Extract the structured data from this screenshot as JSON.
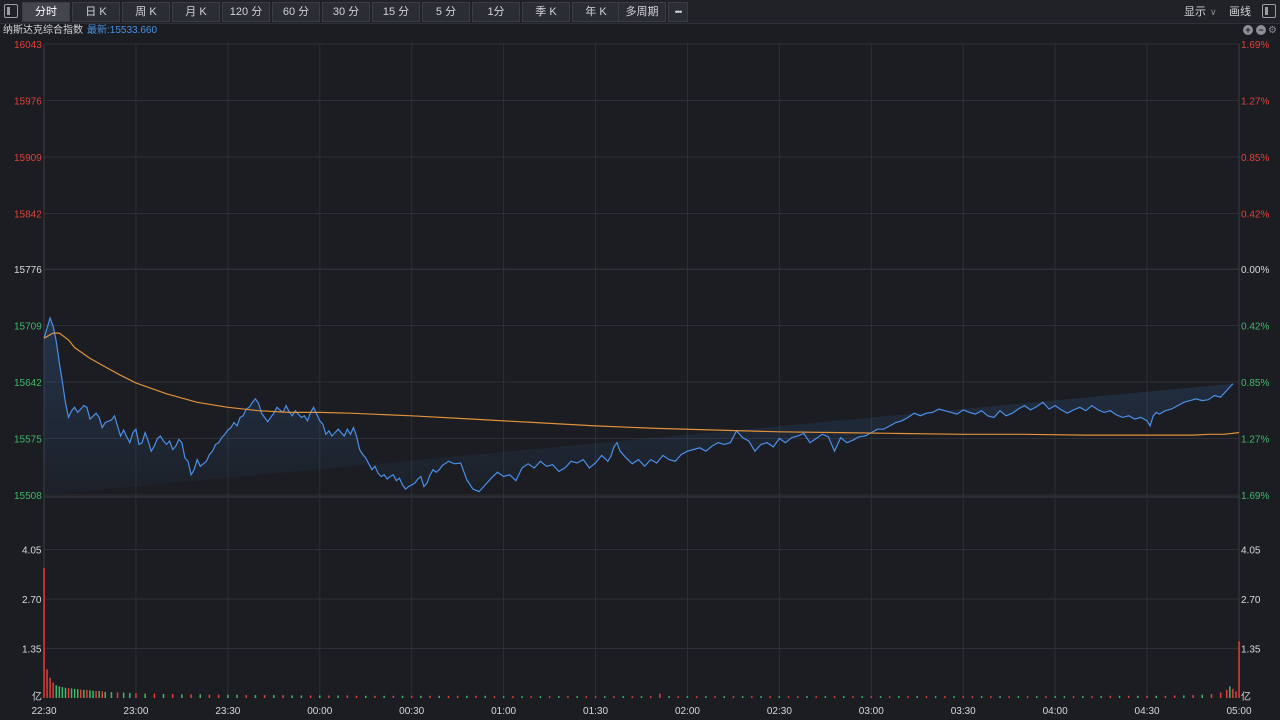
{
  "toolbar": {
    "tabs": [
      {
        "label": "分时",
        "active": true
      },
      {
        "label": "日 K",
        "active": false
      },
      {
        "label": "周 K",
        "active": false
      },
      {
        "label": "月 K",
        "active": false
      },
      {
        "label": "120 分",
        "active": false
      },
      {
        "label": "60 分",
        "active": false
      },
      {
        "label": "30 分",
        "active": false
      },
      {
        "label": "15 分",
        "active": false
      },
      {
        "label": "5 分",
        "active": false
      },
      {
        "label": "1分",
        "active": false
      },
      {
        "label": "季 K",
        "active": false
      },
      {
        "label": "年 K",
        "active": false
      },
      {
        "label": "多周期",
        "active": false
      }
    ],
    "more_label": "•••",
    "display_label": "显示",
    "draw_label": "画线"
  },
  "info": {
    "name": "纳斯达克综合指数",
    "latest": "最新:15533.660"
  },
  "colors": {
    "price_line": "#4a8fe8",
    "avg_line": "#e0913a",
    "up": "#e0403a",
    "down": "#3fb76a",
    "neutral": "#d6d8dc",
    "grid": "#2c2f36"
  },
  "chart_data": {
    "type": "line",
    "title": "",
    "price_axis": {
      "ylim": [
        15508,
        16043
      ],
      "left_ticks": [
        {
          "label": "16043",
          "value": 16043,
          "tone": "up"
        },
        {
          "label": "15976",
          "value": 15976,
          "tone": "up"
        },
        {
          "label": "15909",
          "value": 15909,
          "tone": "up"
        },
        {
          "label": "15842",
          "value": 15842,
          "tone": "up"
        },
        {
          "label": "15776",
          "value": 15776,
          "tone": "neutral"
        },
        {
          "label": "15709",
          "value": 15709,
          "tone": "down"
        },
        {
          "label": "15642",
          "value": 15642,
          "tone": "down"
        },
        {
          "label": "15575",
          "value": 15575,
          "tone": "down"
        },
        {
          "label": "15508",
          "value": 15508,
          "tone": "down"
        }
      ],
      "right_ticks": [
        {
          "label": "1.69%",
          "value": 16043,
          "tone": "up"
        },
        {
          "label": "1.27%",
          "value": 15976,
          "tone": "up"
        },
        {
          "label": "0.85%",
          "value": 15909,
          "tone": "up"
        },
        {
          "label": "0.42%",
          "value": 15842,
          "tone": "up"
        },
        {
          "label": "0.00%",
          "value": 15776,
          "tone": "neutral"
        },
        {
          "label": "0.42%",
          "value": 15709,
          "tone": "down"
        },
        {
          "label": "0.85%",
          "value": 15642,
          "tone": "down"
        },
        {
          "label": "1.27%",
          "value": 15575,
          "tone": "down"
        },
        {
          "label": "1.69%",
          "value": 15508,
          "tone": "down"
        }
      ]
    },
    "volume_axis": {
      "ylim": [
        0,
        5.4
      ],
      "ticks": [
        {
          "label": "4.05",
          "value": 4.05
        },
        {
          "label": "2.70",
          "value": 2.7
        },
        {
          "label": "1.35",
          "value": 1.35
        }
      ],
      "unit_label": "亿"
    },
    "x_ticks": [
      "22:30",
      "23:00",
      "23:30",
      "00:00",
      "00:30",
      "01:00",
      "01:30",
      "02:00",
      "02:30",
      "03:00",
      "03:30",
      "04:00",
      "04:30",
      "05:00"
    ],
    "x_tick_minutes": [
      0,
      30,
      60,
      90,
      120,
      150,
      180,
      210,
      240,
      270,
      300,
      330,
      360,
      390
    ],
    "price_series": {
      "name": "",
      "x_minutes": [
        0,
        2,
        3,
        4,
        5,
        6,
        7,
        8,
        9,
        10,
        11,
        12,
        13,
        14,
        15,
        17,
        18,
        19,
        20,
        22,
        23,
        24,
        25,
        26,
        27,
        28,
        29,
        30,
        31,
        32,
        33,
        34,
        35,
        36,
        37,
        38,
        39,
        40,
        41,
        42,
        43,
        44,
        45,
        46,
        47,
        48,
        49,
        50,
        51,
        52,
        53,
        54,
        55,
        56,
        57,
        58,
        59,
        60,
        61,
        62,
        63,
        64,
        65,
        66,
        67,
        68,
        69,
        70,
        71,
        72,
        73,
        74,
        75,
        76,
        77,
        78,
        79,
        80,
        81,
        82,
        83,
        84,
        85,
        86,
        87,
        88,
        89,
        90,
        91,
        92,
        93,
        94,
        95,
        96,
        97,
        98,
        99,
        100,
        101,
        102,
        103,
        104,
        105,
        106,
        107,
        108,
        109,
        110,
        111,
        112,
        113,
        114,
        115,
        116,
        117,
        118,
        119,
        120,
        121,
        122,
        123,
        124,
        125,
        126,
        127,
        128,
        129,
        130,
        132,
        134,
        136,
        138,
        140,
        142,
        144,
        146,
        148,
        150,
        152,
        154,
        156,
        158,
        160,
        162,
        164,
        166,
        168,
        170,
        172,
        174,
        176,
        178,
        180,
        182,
        184,
        185,
        186,
        187,
        188,
        190,
        192,
        194,
        196,
        198,
        200,
        202,
        204,
        206,
        208,
        210,
        212,
        214,
        216,
        218,
        220,
        222,
        224,
        226,
        228,
        230,
        232,
        234,
        236,
        238,
        240,
        242,
        244,
        246,
        248,
        250,
        252,
        254,
        256,
        258,
        260,
        262,
        264,
        266,
        268,
        270,
        272,
        274,
        276,
        278,
        280,
        282,
        284,
        286,
        288,
        290,
        292,
        294,
        296,
        298,
        300,
        302,
        304,
        306,
        308,
        310,
        312,
        314,
        316,
        318,
        320,
        322,
        324,
        326,
        328,
        330,
        332,
        334,
        336,
        338,
        340,
        342,
        344,
        346,
        348,
        350,
        352,
        354,
        356,
        358,
        360,
        361,
        362,
        363,
        364,
        366,
        368,
        370,
        372,
        374,
        376,
        378,
        380,
        382,
        384,
        386,
        388,
        390
      ],
      "values": [
        15694,
        15718,
        15708,
        15690,
        15665,
        15642,
        15618,
        15600,
        15608,
        15612,
        15606,
        15610,
        15614,
        15612,
        15598,
        15605,
        15600,
        15588,
        15594,
        15597,
        15602,
        15590,
        15578,
        15585,
        15577,
        15570,
        15582,
        15586,
        15568,
        15570,
        15582,
        15572,
        15560,
        15566,
        15575,
        15578,
        15572,
        15568,
        15572,
        15562,
        15566,
        15574,
        15570,
        15552,
        15548,
        15532,
        15538,
        15550,
        15542,
        15545,
        15548,
        15556,
        15560,
        15568,
        15570,
        15576,
        15580,
        15585,
        15588,
        15594,
        15590,
        15600,
        15602,
        15610,
        15612,
        15618,
        15622,
        15617,
        15605,
        15600,
        15595,
        15600,
        15605,
        15612,
        15609,
        15606,
        15614,
        15607,
        15602,
        15608,
        15604,
        15600,
        15602,
        15596,
        15606,
        15612,
        15604,
        15596,
        15592,
        15580,
        15584,
        15578,
        15582,
        15586,
        15582,
        15578,
        15586,
        15580,
        15588,
        15578,
        15562,
        15556,
        15552,
        15545,
        15538,
        15542,
        15534,
        15530,
        15532,
        15527,
        15530,
        15532,
        15525,
        15528,
        15520,
        15515,
        15518,
        15520,
        15522,
        15527,
        15530,
        15518,
        15522,
        15532,
        15538,
        15535,
        15538,
        15543,
        15548,
        15545,
        15546,
        15526,
        15515,
        15512,
        15520,
        15528,
        15535,
        15530,
        15532,
        15525,
        15540,
        15545,
        15540,
        15548,
        15542,
        15544,
        15536,
        15540,
        15548,
        15546,
        15550,
        15540,
        15546,
        15555,
        15548,
        15554,
        15565,
        15570,
        15560,
        15552,
        15545,
        15550,
        15542,
        15550,
        15546,
        15555,
        15550,
        15548,
        15556,
        15560,
        15562,
        15564,
        15560,
        15566,
        15570,
        15568,
        15570,
        15584,
        15576,
        15572,
        15560,
        15568,
        15570,
        15565,
        15575,
        15570,
        15576,
        15578,
        15581,
        15570,
        15575,
        15580,
        15577,
        15560,
        15576,
        15570,
        15573,
        15577,
        15578,
        15582,
        15586,
        15586,
        15590,
        15594,
        15596,
        15600,
        15605,
        15602,
        15605,
        15606,
        15610,
        15608,
        15606,
        15604,
        15609,
        15606,
        15604,
        15608,
        15602,
        15600,
        15608,
        15602,
        15605,
        15610,
        15614,
        15609,
        15613,
        15618,
        15610,
        15614,
        15609,
        15605,
        15609,
        15612,
        15608,
        15614,
        15609,
        15606,
        15608,
        15603,
        15600,
        15602,
        15598,
        15600,
        15596,
        15590,
        15602,
        15606,
        15604,
        15608,
        15610,
        15614,
        15618,
        15620,
        15622,
        15620,
        15621,
        15626,
        15624,
        15632,
        15640
      ],
      "last_value": 15533.66
    },
    "avg_series": {
      "name": "",
      "x_minutes": [
        0,
        3,
        5,
        8,
        10,
        15,
        20,
        25,
        30,
        40,
        50,
        60,
        70,
        80,
        90,
        100,
        120,
        140,
        160,
        180,
        200,
        220,
        240,
        260,
        280,
        300,
        320,
        340,
        360,
        375,
        380,
        385,
        390
      ],
      "values": [
        15694,
        15700,
        15700,
        15692,
        15683,
        15670,
        15660,
        15650,
        15641,
        15628,
        15618,
        15612,
        15608,
        15606,
        15606,
        15605,
        15602,
        15598,
        15594,
        15590,
        15587,
        15585,
        15583,
        15582,
        15581,
        15580,
        15580,
        15579,
        15579,
        15579,
        15580,
        15580,
        15582
      ]
    },
    "volume_series": {
      "name": "",
      "x_minutes": [
        0,
        1,
        2,
        3,
        4,
        5,
        6,
        7,
        8,
        9,
        10,
        11,
        12,
        13,
        14,
        15,
        16,
        17,
        18,
        19,
        20,
        22,
        24,
        26,
        28,
        30,
        33,
        36,
        39,
        42,
        45,
        48,
        51,
        54,
        57,
        60,
        63,
        66,
        69,
        72,
        75,
        78,
        81,
        84,
        87,
        90,
        93,
        96,
        99,
        102,
        105,
        108,
        111,
        114,
        117,
        120,
        123,
        126,
        129,
        132,
        135,
        138,
        141,
        144,
        147,
        150,
        153,
        156,
        159,
        162,
        165,
        168,
        171,
        174,
        177,
        180,
        183,
        186,
        189,
        192,
        195,
        198,
        201,
        204,
        207,
        210,
        213,
        216,
        219,
        222,
        225,
        228,
        231,
        234,
        237,
        240,
        243,
        246,
        249,
        252,
        255,
        258,
        261,
        264,
        267,
        270,
        273,
        276,
        279,
        282,
        285,
        288,
        291,
        294,
        297,
        300,
        303,
        306,
        309,
        312,
        315,
        318,
        321,
        324,
        327,
        330,
        333,
        336,
        339,
        342,
        345,
        348,
        351,
        354,
        357,
        360,
        363,
        366,
        369,
        372,
        375,
        378,
        381,
        384,
        386,
        387,
        388,
        389,
        390
      ],
      "values": [
        3.55,
        0.78,
        0.55,
        0.42,
        0.35,
        0.32,
        0.3,
        0.28,
        0.27,
        0.26,
        0.25,
        0.24,
        0.23,
        0.22,
        0.22,
        0.21,
        0.2,
        0.19,
        0.19,
        0.18,
        0.17,
        0.16,
        0.15,
        0.15,
        0.14,
        0.13,
        0.12,
        0.12,
        0.11,
        0.11,
        0.1,
        0.1,
        0.1,
        0.09,
        0.09,
        0.09,
        0.09,
        0.08,
        0.08,
        0.08,
        0.08,
        0.08,
        0.07,
        0.07,
        0.07,
        0.07,
        0.07,
        0.07,
        0.07,
        0.06,
        0.06,
        0.06,
        0.06,
        0.06,
        0.06,
        0.06,
        0.06,
        0.06,
        0.06,
        0.06,
        0.06,
        0.06,
        0.06,
        0.06,
        0.05,
        0.05,
        0.05,
        0.05,
        0.05,
        0.05,
        0.05,
        0.05,
        0.05,
        0.05,
        0.05,
        0.05,
        0.05,
        0.05,
        0.05,
        0.05,
        0.05,
        0.05,
        0.12,
        0.05,
        0.05,
        0.05,
        0.05,
        0.05,
        0.05,
        0.05,
        0.05,
        0.05,
        0.05,
        0.05,
        0.05,
        0.05,
        0.05,
        0.05,
        0.05,
        0.05,
        0.05,
        0.05,
        0.05,
        0.05,
        0.05,
        0.05,
        0.05,
        0.05,
        0.05,
        0.05,
        0.05,
        0.05,
        0.05,
        0.05,
        0.05,
        0.05,
        0.05,
        0.05,
        0.05,
        0.05,
        0.05,
        0.05,
        0.05,
        0.05,
        0.05,
        0.05,
        0.05,
        0.05,
        0.05,
        0.05,
        0.05,
        0.06,
        0.06,
        0.06,
        0.06,
        0.06,
        0.06,
        0.06,
        0.07,
        0.07,
        0.08,
        0.09,
        0.11,
        0.15,
        0.22,
        0.32,
        0.25,
        0.18,
        1.55
      ],
      "colors": [
        "up",
        "up",
        "up",
        "up",
        "down",
        "down",
        "down",
        "down",
        "up",
        "down",
        "down",
        "down",
        "up",
        "down",
        "up",
        "down",
        "down",
        "up",
        "down",
        "up",
        "down",
        "down",
        "up",
        "down",
        "down",
        "up",
        "down",
        "up",
        "down",
        "up",
        "down",
        "up",
        "down",
        "up",
        "up",
        "down",
        "down",
        "up",
        "down",
        "up",
        "down",
        "up",
        "down",
        "down",
        "up",
        "down",
        "up",
        "down",
        "up",
        "up",
        "down",
        "up",
        "down",
        "up",
        "down",
        "up",
        "down",
        "up",
        "down",
        "up",
        "up",
        "down",
        "up",
        "down",
        "up",
        "down",
        "up",
        "down",
        "up",
        "down",
        "up",
        "down",
        "up",
        "down",
        "up",
        "up",
        "down",
        "up",
        "down",
        "up",
        "down",
        "up",
        "up",
        "down",
        "up",
        "down",
        "up",
        "down",
        "up",
        "down",
        "up",
        "down",
        "up",
        "down",
        "up",
        "down",
        "up",
        "up",
        "down",
        "up",
        "down",
        "up",
        "down",
        "up",
        "down",
        "up",
        "down",
        "up",
        "down",
        "up",
        "down",
        "up",
        "down",
        "up",
        "down",
        "up",
        "up",
        "down",
        "up",
        "down",
        "up",
        "down",
        "up",
        "down",
        "up",
        "down",
        "down",
        "up",
        "down",
        "up",
        "down",
        "up",
        "down",
        "up",
        "down",
        "up",
        "down",
        "up",
        "up",
        "down",
        "up",
        "down",
        "up",
        "up",
        "up",
        "down",
        "up",
        "up",
        "up",
        "up"
      ]
    }
  }
}
